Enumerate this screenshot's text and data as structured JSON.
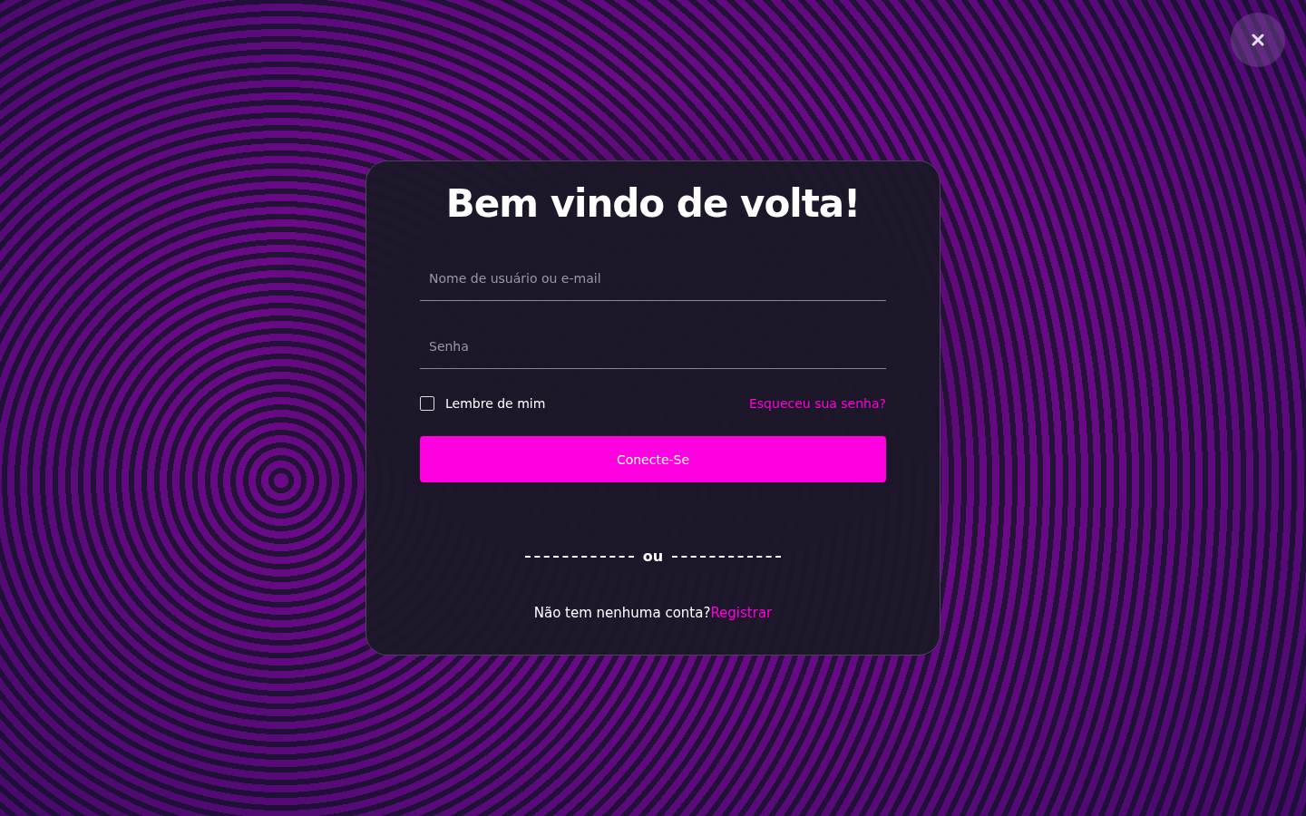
{
  "title": "Bem vindo de volta!",
  "fields": [
    {
      "placeholder": "Nome de usuário ou e-mail"
    },
    {
      "placeholder": "Senha"
    }
  ],
  "remember": {
    "label": "Lembre de mim",
    "checked": false
  },
  "forgot_link": "Esqueceu sua senha?",
  "submit_button": "Conecte-Se",
  "divider_text": "ou",
  "register": {
    "prompt": "Não tem nenhuma conta?",
    "link": "Registrar"
  }
}
